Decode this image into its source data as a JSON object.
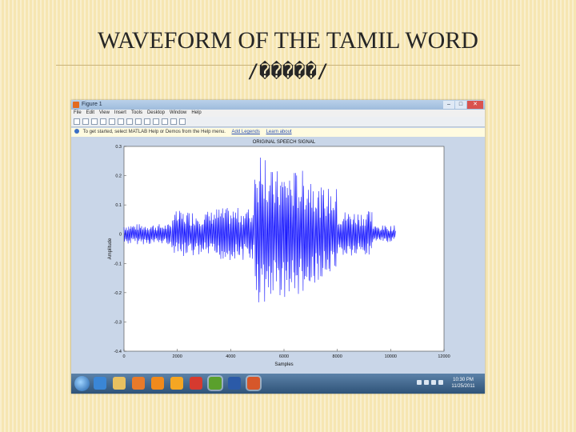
{
  "slide": {
    "title": "WAVEFORM OF THE TAMIL WORD",
    "subtitle": "/�����/"
  },
  "window": {
    "title": "Figure 1",
    "buttons": [
      "–",
      "□",
      "✕"
    ]
  },
  "menu": {
    "items": [
      "File",
      "Edit",
      "View",
      "Insert",
      "Tools",
      "Desktop",
      "Window",
      "Help"
    ]
  },
  "helpbar": {
    "text": "To get started, select MATLAB Help or Demos from the Help menu.",
    "link1": "Add Legends",
    "link2": "Learn about"
  },
  "colors": {
    "signal": "#1414ff",
    "plot_background": "#ffffff",
    "figure_background": "#c9d6e8"
  },
  "icons": {
    "start": "windows-start-icon",
    "taskbar": [
      "ie-icon",
      "folder-icon",
      "media-icon",
      "firefox-icon",
      "paint-icon",
      "pdf-icon",
      "app-icon",
      "word-icon",
      "matlab-icon"
    ]
  },
  "tray": {
    "time": "10:30 PM",
    "date": "11/25/2011"
  },
  "chart_data": {
    "type": "line",
    "title": "ORIGINAL SPEECH SIGNAL",
    "xlabel": "Samples",
    "ylabel": "Amplitude",
    "xlim": [
      0,
      12000
    ],
    "ylim": [
      -0.4,
      0.3
    ],
    "xticks": [
      "0",
      "2000",
      "4000",
      "6000",
      "8000",
      "10000",
      "12000"
    ],
    "yticks": [
      "0.3",
      "0.2",
      "0.1",
      "0",
      "-0.1",
      "-0.2",
      "-0.3",
      "-0.4"
    ],
    "series": [
      {
        "segments": [
          {
            "x_start": 0,
            "x_end": 1800,
            "peak": 0.035
          },
          {
            "x_start": 1800,
            "x_end": 3300,
            "peak": 0.08
          },
          {
            "x_start": 3300,
            "x_end": 4900,
            "peak": 0.09
          },
          {
            "x_start": 4900,
            "x_end": 5300,
            "peak": 0.28
          },
          {
            "x_start": 5300,
            "x_end": 6100,
            "peak": 0.22
          },
          {
            "x_start": 6100,
            "x_end": 7200,
            "peak": 0.22
          },
          {
            "x_start": 7200,
            "x_end": 8000,
            "peak": 0.16
          },
          {
            "x_start": 8000,
            "x_end": 9300,
            "peak": 0.08
          },
          {
            "x_start": 9300,
            "x_end": 10200,
            "peak": 0.03
          }
        ]
      }
    ]
  }
}
